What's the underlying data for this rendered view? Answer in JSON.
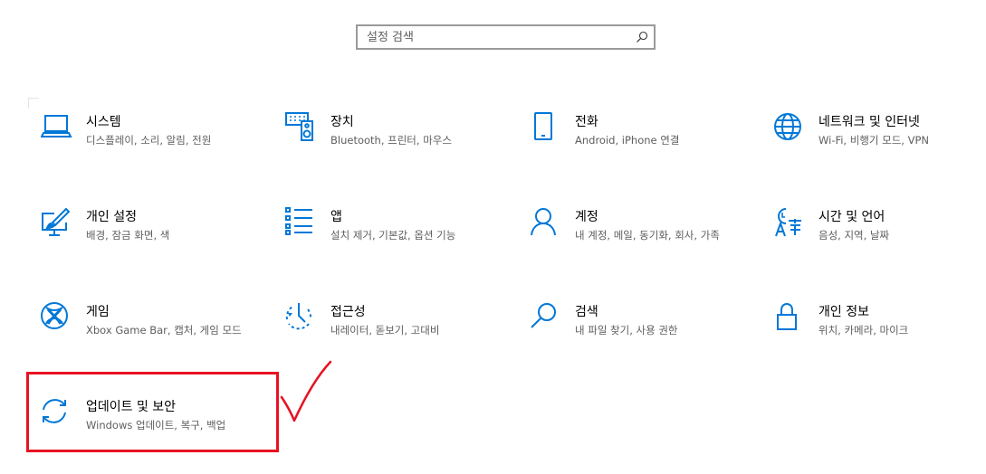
{
  "search": {
    "placeholder": "설정 검색",
    "icon": "search-icon"
  },
  "colors": {
    "accent": "#0078d7",
    "annotation": "#e81123"
  },
  "tiles": [
    {
      "title": "시스템",
      "desc": "디스플레이, 소리, 알림, 전원",
      "icon": "laptop-icon"
    },
    {
      "title": "장치",
      "desc": "Bluetooth, 프린터, 마우스",
      "icon": "keyboard-speaker-icon"
    },
    {
      "title": "전화",
      "desc": "Android, iPhone 연결",
      "icon": "phone-icon"
    },
    {
      "title": "네트워크 및 인터넷",
      "desc": "Wi-Fi, 비행기 모드, VPN",
      "icon": "globe-icon"
    },
    {
      "title": "개인 설정",
      "desc": "배경, 잠금 화면, 색",
      "icon": "paint-monitor-icon"
    },
    {
      "title": "앱",
      "desc": "설치 제거, 기본값, 옵션 기능",
      "icon": "app-list-icon"
    },
    {
      "title": "계정",
      "desc": "내 계정, 메일, 동기화, 회사, 가족",
      "icon": "person-icon"
    },
    {
      "title": "시간 및 언어",
      "desc": "음성, 지역, 날짜",
      "icon": "time-language-icon"
    },
    {
      "title": "게임",
      "desc": "Xbox Game Bar, 캡처, 게임 모드",
      "icon": "xbox-icon"
    },
    {
      "title": "접근성",
      "desc": "내레이터, 돋보기, 고대비",
      "icon": "ease-of-access-icon"
    },
    {
      "title": "검색",
      "desc": "내 파일 찾기, 사용 권한",
      "icon": "magnifier-icon"
    },
    {
      "title": "개인 정보",
      "desc": "위치, 카메라, 마이크",
      "icon": "lock-icon"
    },
    {
      "title": "업데이트 및 보안",
      "desc": "Windows 업데이트, 복구, 백업",
      "icon": "sync-icon"
    }
  ]
}
